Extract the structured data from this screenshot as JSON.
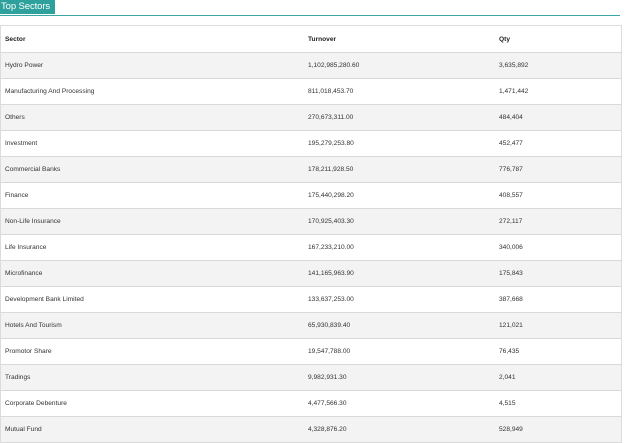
{
  "panel": {
    "title": "Top Sectors"
  },
  "table": {
    "columns": [
      "Sector",
      "Turnover",
      "Qty"
    ],
    "rows": [
      [
        "Hydro Power",
        "1,102,985,280.60",
        "3,635,892"
      ],
      [
        "Manufacturing And Processing",
        "811,018,453.70",
        "1,471,442"
      ],
      [
        "Others",
        "270,673,311.00",
        "484,404"
      ],
      [
        "Investment",
        "195,279,253.80",
        "452,477"
      ],
      [
        "Commercial Banks",
        "178,211,928.50",
        "776,787"
      ],
      [
        "Finance",
        "175,440,298.20",
        "408,557"
      ],
      [
        "Non-Life Insurance",
        "170,925,403.30",
        "272,117"
      ],
      [
        "Life Insurance",
        "167,233,210.00",
        "340,006"
      ],
      [
        "Microfinance",
        "141,165,963.90",
        "175,843"
      ],
      [
        "Development Bank Limited",
        "133,637,253.00",
        "387,668"
      ],
      [
        "Hotels And Tourism",
        "65,930,839.40",
        "121,021"
      ],
      [
        "Promotor Share",
        "19,547,788.00",
        "76,435"
      ],
      [
        "Tradings",
        "9,982,931.30",
        "2,041"
      ],
      [
        "Corporate Debenture",
        "4,477,566.30",
        "4,515"
      ],
      [
        "Mutual Fund",
        "4,328,876.20",
        "528,949"
      ]
    ]
  },
  "colors": {
    "accent": "#2ea19c",
    "stripe": "#f3f3f3",
    "border": "#d9d9d9"
  }
}
